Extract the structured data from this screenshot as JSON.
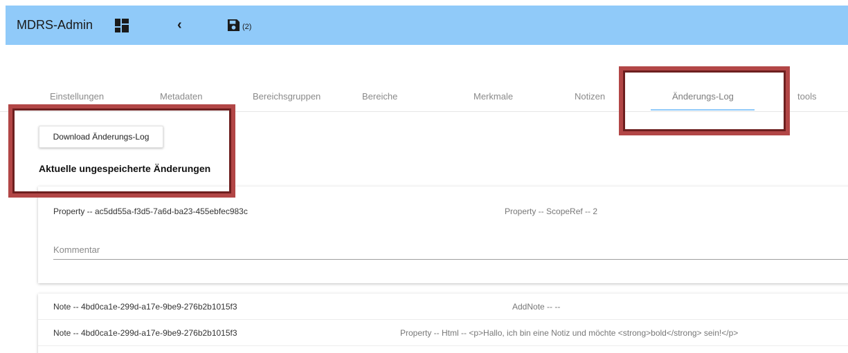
{
  "header": {
    "title": "MDRS-Admin",
    "save_count": "(2)",
    "icons": [
      "dashboard-icon",
      "chevron-left-icon",
      "save-icon"
    ],
    "bar_color": "#90caf9"
  },
  "tabs": [
    {
      "label": "Einstellungen"
    },
    {
      "label": "Metadaten"
    },
    {
      "label": "Bereichsgruppen"
    },
    {
      "label": "Bereiche"
    },
    {
      "label": "Merkmale"
    },
    {
      "label": "Notizen"
    },
    {
      "label": "Änderungs-Log",
      "active": true
    },
    {
      "label": "tools"
    }
  ],
  "log": {
    "download_label": "Download Änderungs-Log",
    "section_title": "Aktuelle ungespeicherte Änderungen",
    "card": {
      "target": "Property -- ac5dd55a-f3d5-7a6d-ba23-455ebfec983c",
      "change": "Property -- ScopeRef -- 2",
      "comment_placeholder": "Kommentar",
      "comment_value": ""
    },
    "rows": [
      {
        "target": "Note -- 4bd0ca1e-299d-a17e-9be9-276b2b1015f3",
        "change": "AddNote -- --"
      },
      {
        "target": "Note -- 4bd0ca1e-299d-a17e-9be9-276b2b1015f3",
        "change": "Property -- Html -- <p>Hallo, ich bin eine Notiz und möchte <strong>bold</strong> sein!</p>"
      }
    ]
  },
  "highlight_color": "#b24646"
}
